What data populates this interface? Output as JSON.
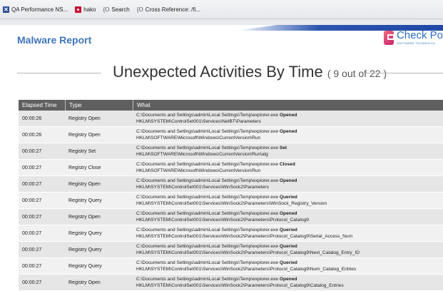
{
  "bookmarks": [
    {
      "icon": "qa-icon",
      "label": "QA Performance NS..."
    },
    {
      "icon": "hako-icon",
      "label": "hako"
    },
    {
      "icon": "brace-icon",
      "label": "Search"
    },
    {
      "icon": "brace-icon",
      "label": "Cross Reference: /fi..."
    }
  ],
  "report": {
    "title": "Malware Report",
    "logo_text": "Check Po",
    "logo_sub": "SOFTWARE TECHNOLOG"
  },
  "section": {
    "title": "Unexpected Activities By Time",
    "count": "( 9 out of 22 )"
  },
  "table": {
    "headers": [
      "Elapsed Time",
      "Type",
      "What"
    ],
    "rows": [
      {
        "time": "00:00:26",
        "type": "Registry Open",
        "path": "C:\\Documents and Settings\\admin\\Local Settings\\Temp\\explorer.exe",
        "action": "Opened",
        "key": "HKLM\\SYSTEM\\ControlSet001\\Services\\NetBT\\Parameters"
      },
      {
        "time": "00:00:26",
        "type": "Registry Open",
        "path": "C:\\Documents and Settings\\admin\\Local Settings\\Temp\\explorer.exe",
        "action": "Opened",
        "key": "HKLM\\SOFTWARE\\Microsoft\\Windows\\CurrentVersion\\Run"
      },
      {
        "time": "00:00:27",
        "type": "Registry Set",
        "path": "C:\\Documents and Settings\\admin\\Local Settings\\Temp\\explorer.exe",
        "action": "Set",
        "key": "HKLM\\SOFTWARE\\Microsoft\\Windows\\CurrentVersion\\Run\\alg"
      },
      {
        "time": "00:00:27",
        "type": "Registry Close",
        "path": "C:\\Documents and Settings\\admin\\Local Settings\\Temp\\explorer.exe",
        "action": "Closed",
        "key": "HKLM\\SOFTWARE\\Microsoft\\Windows\\CurrentVersion\\Run"
      },
      {
        "time": "00:00:27",
        "type": "Registry Open",
        "path": "C:\\Documents and Settings\\admin\\Local Settings\\Temp\\explorer.exe",
        "action": "Opened",
        "key": "HKLM\\SYSTEM\\ControlSet001\\Services\\WinSock2\\Parameters"
      },
      {
        "time": "00:00:27",
        "type": "Registry Query",
        "path": "C:\\Documents and Settings\\admin\\Local Settings\\Temp\\explorer.exe",
        "action": "Queried",
        "key": "HKLM\\SYSTEM\\ControlSet001\\Services\\WinSock2\\Parameters\\WinSock_Registry_Version"
      },
      {
        "time": "00:00:27",
        "type": "Registry Open",
        "path": "C:\\Documents and Settings\\admin\\Local Settings\\Temp\\explorer.exe",
        "action": "Opened",
        "key": "HKLM\\SYSTEM\\ControlSet001\\Services\\WinSock2\\Parameters\\Protocol_Catalog9"
      },
      {
        "time": "00:00:27",
        "type": "Registry Query",
        "path": "C:\\Documents and Settings\\admin\\Local Settings\\Temp\\explorer.exe",
        "action": "Queried",
        "key": "HKLM\\SYSTEM\\ControlSet001\\Services\\WinSock2\\Parameters\\Protocol_Catalog9\\Serial_Access_Num"
      },
      {
        "time": "00:00:27",
        "type": "Registry Query",
        "path": "C:\\Documents and Settings\\admin\\Local Settings\\Temp\\explorer.exe",
        "action": "Queried",
        "key": "HKLM\\SYSTEM\\ControlSet001\\Services\\WinSock2\\Parameters\\Protocol_Catalog9\\Next_Catalog_Entry_ID"
      },
      {
        "time": "00:00:27",
        "type": "Registry Query",
        "path": "C:\\Documents and Settings\\admin\\Local Settings\\Temp\\explorer.exe",
        "action": "Queried",
        "key": "HKLM\\SYSTEM\\ControlSet001\\Services\\WinSock2\\Parameters\\Protocol_Catalog9\\Num_Catalog_Entries"
      },
      {
        "time": "00:00:27",
        "type": "Registry Open",
        "path": "C:\\Documents and Settings\\admin\\Local Settings\\Temp\\explorer.exe",
        "action": "Opened",
        "key": "HKLM\\SYSTEM\\ControlSet001\\Services\\WinSock2\\Parameters\\Protocol_Catalog9\\Catalog_Entries"
      }
    ]
  },
  "colors": {
    "title_blue": "#3e74b9",
    "header_band": "#2b55b0",
    "table_header": "#5f5f5f",
    "logo_pink": "#c8246c"
  }
}
